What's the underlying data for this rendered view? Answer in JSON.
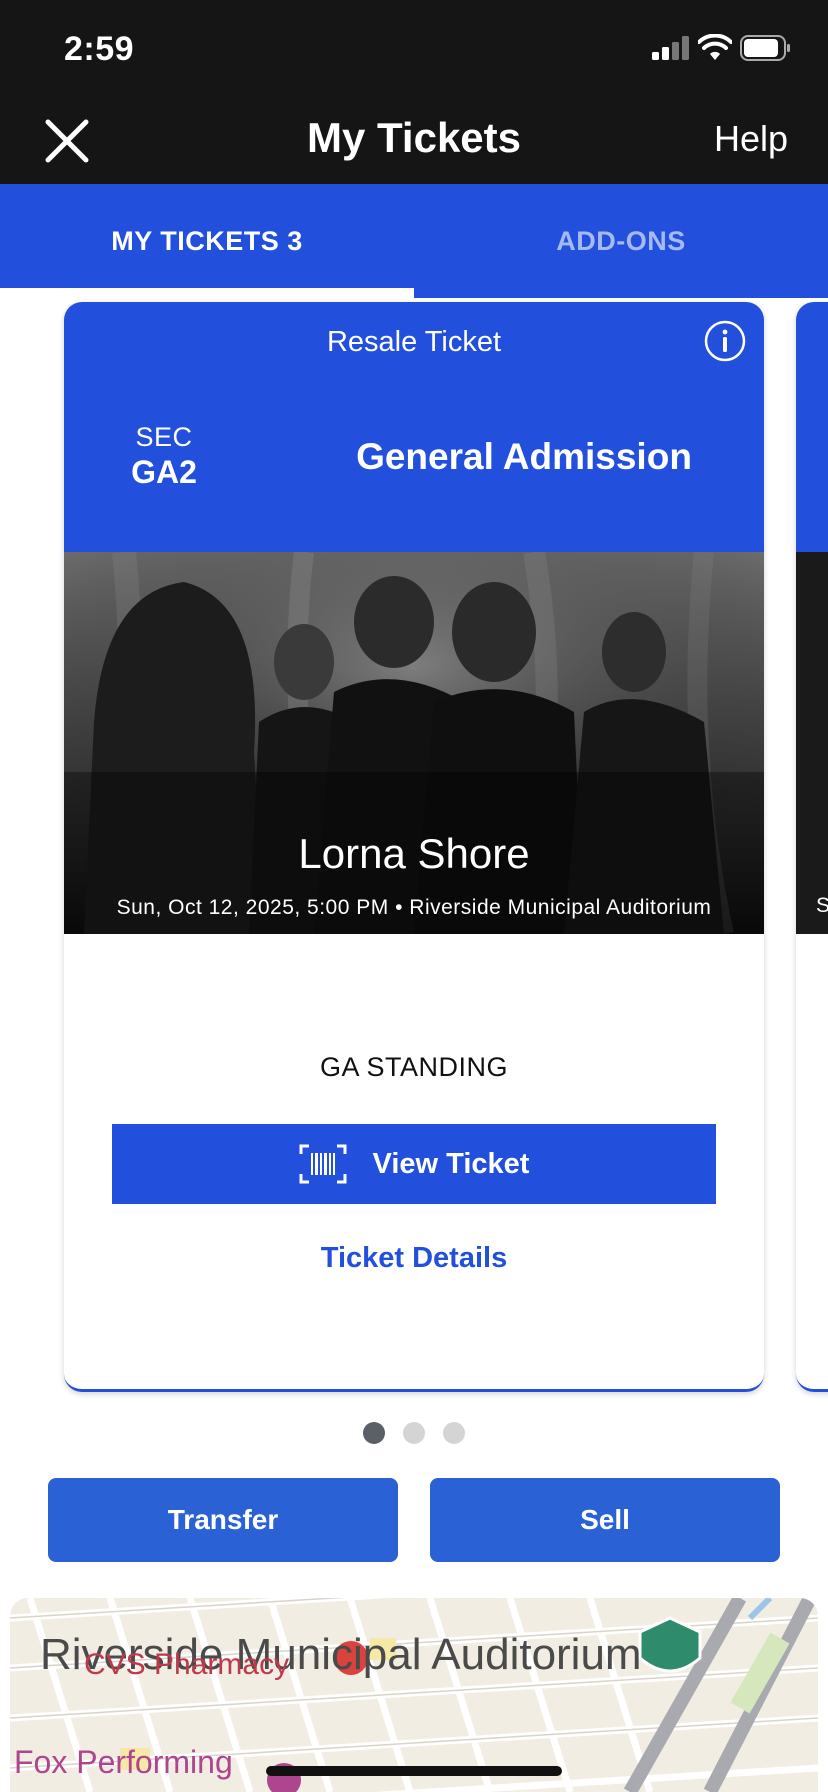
{
  "status_bar": {
    "time": "2:59"
  },
  "header": {
    "title": "My Tickets",
    "help_label": "Help"
  },
  "tabs": [
    {
      "label": "MY TICKETS 3",
      "active": true
    },
    {
      "label": "ADD-ONS",
      "active": false
    }
  ],
  "ticket": {
    "type_label": "Resale Ticket",
    "section_label": "SEC",
    "section_value": "GA2",
    "admission": "General Admission",
    "artist": "Lorna Shore",
    "event_meta": "Sun, Oct 12, 2025, 5:00 PM • Riverside Municipal Auditorium",
    "area_label": "GA STANDING",
    "view_ticket_label": "View Ticket",
    "details_label": "Ticket Details"
  },
  "next_card_peek_text": "S",
  "pagination": {
    "total": 3,
    "current": 1
  },
  "actions": {
    "transfer_label": "Transfer",
    "sell_label": "Sell"
  },
  "map": {
    "venue_label": "Riverside Municipal Auditorium",
    "poi_1": "CVS Pharmacy",
    "poi_2": "Fox Performing"
  },
  "colors": {
    "brand_blue": "#2250dc",
    "button_blue": "#2a62d6",
    "header_bg": "#151515"
  }
}
